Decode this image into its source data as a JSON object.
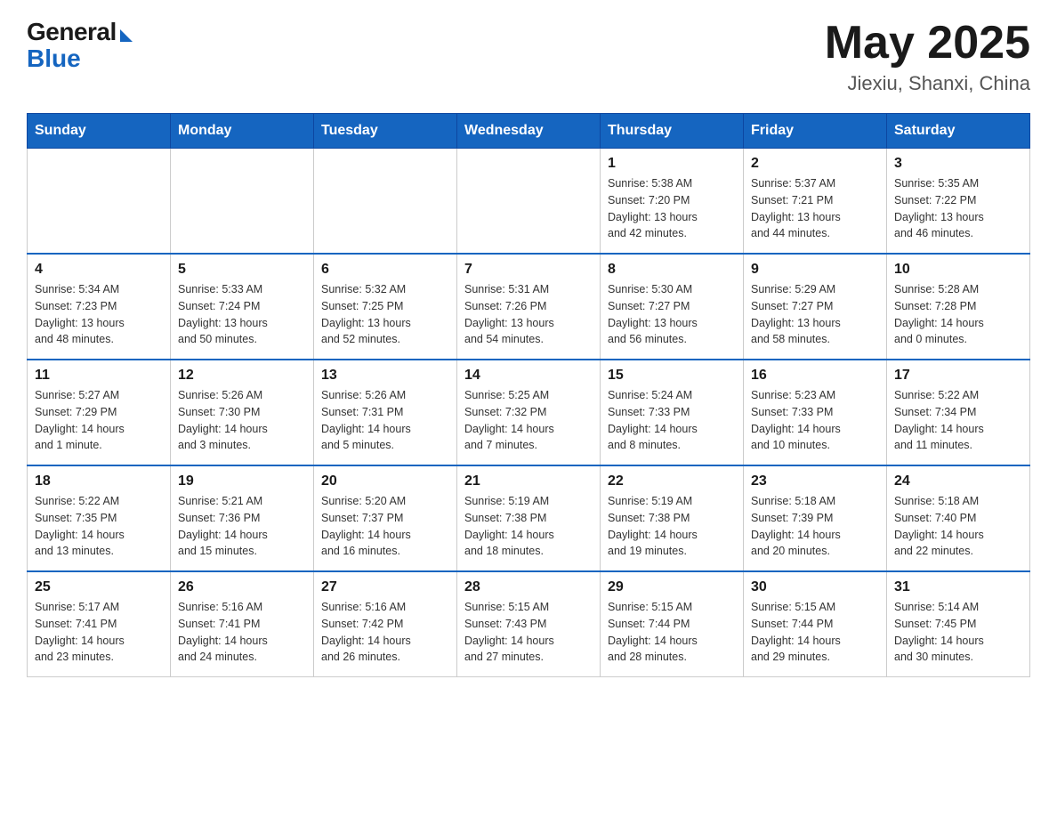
{
  "header": {
    "logo_general": "General",
    "logo_blue": "Blue",
    "month_year": "May 2025",
    "location": "Jiexiu, Shanxi, China"
  },
  "days_of_week": [
    "Sunday",
    "Monday",
    "Tuesday",
    "Wednesday",
    "Thursday",
    "Friday",
    "Saturday"
  ],
  "weeks": [
    [
      {
        "day": "",
        "info": ""
      },
      {
        "day": "",
        "info": ""
      },
      {
        "day": "",
        "info": ""
      },
      {
        "day": "",
        "info": ""
      },
      {
        "day": "1",
        "info": "Sunrise: 5:38 AM\nSunset: 7:20 PM\nDaylight: 13 hours\nand 42 minutes."
      },
      {
        "day": "2",
        "info": "Sunrise: 5:37 AM\nSunset: 7:21 PM\nDaylight: 13 hours\nand 44 minutes."
      },
      {
        "day": "3",
        "info": "Sunrise: 5:35 AM\nSunset: 7:22 PM\nDaylight: 13 hours\nand 46 minutes."
      }
    ],
    [
      {
        "day": "4",
        "info": "Sunrise: 5:34 AM\nSunset: 7:23 PM\nDaylight: 13 hours\nand 48 minutes."
      },
      {
        "day": "5",
        "info": "Sunrise: 5:33 AM\nSunset: 7:24 PM\nDaylight: 13 hours\nand 50 minutes."
      },
      {
        "day": "6",
        "info": "Sunrise: 5:32 AM\nSunset: 7:25 PM\nDaylight: 13 hours\nand 52 minutes."
      },
      {
        "day": "7",
        "info": "Sunrise: 5:31 AM\nSunset: 7:26 PM\nDaylight: 13 hours\nand 54 minutes."
      },
      {
        "day": "8",
        "info": "Sunrise: 5:30 AM\nSunset: 7:27 PM\nDaylight: 13 hours\nand 56 minutes."
      },
      {
        "day": "9",
        "info": "Sunrise: 5:29 AM\nSunset: 7:27 PM\nDaylight: 13 hours\nand 58 minutes."
      },
      {
        "day": "10",
        "info": "Sunrise: 5:28 AM\nSunset: 7:28 PM\nDaylight: 14 hours\nand 0 minutes."
      }
    ],
    [
      {
        "day": "11",
        "info": "Sunrise: 5:27 AM\nSunset: 7:29 PM\nDaylight: 14 hours\nand 1 minute."
      },
      {
        "day": "12",
        "info": "Sunrise: 5:26 AM\nSunset: 7:30 PM\nDaylight: 14 hours\nand 3 minutes."
      },
      {
        "day": "13",
        "info": "Sunrise: 5:26 AM\nSunset: 7:31 PM\nDaylight: 14 hours\nand 5 minutes."
      },
      {
        "day": "14",
        "info": "Sunrise: 5:25 AM\nSunset: 7:32 PM\nDaylight: 14 hours\nand 7 minutes."
      },
      {
        "day": "15",
        "info": "Sunrise: 5:24 AM\nSunset: 7:33 PM\nDaylight: 14 hours\nand 8 minutes."
      },
      {
        "day": "16",
        "info": "Sunrise: 5:23 AM\nSunset: 7:33 PM\nDaylight: 14 hours\nand 10 minutes."
      },
      {
        "day": "17",
        "info": "Sunrise: 5:22 AM\nSunset: 7:34 PM\nDaylight: 14 hours\nand 11 minutes."
      }
    ],
    [
      {
        "day": "18",
        "info": "Sunrise: 5:22 AM\nSunset: 7:35 PM\nDaylight: 14 hours\nand 13 minutes."
      },
      {
        "day": "19",
        "info": "Sunrise: 5:21 AM\nSunset: 7:36 PM\nDaylight: 14 hours\nand 15 minutes."
      },
      {
        "day": "20",
        "info": "Sunrise: 5:20 AM\nSunset: 7:37 PM\nDaylight: 14 hours\nand 16 minutes."
      },
      {
        "day": "21",
        "info": "Sunrise: 5:19 AM\nSunset: 7:38 PM\nDaylight: 14 hours\nand 18 minutes."
      },
      {
        "day": "22",
        "info": "Sunrise: 5:19 AM\nSunset: 7:38 PM\nDaylight: 14 hours\nand 19 minutes."
      },
      {
        "day": "23",
        "info": "Sunrise: 5:18 AM\nSunset: 7:39 PM\nDaylight: 14 hours\nand 20 minutes."
      },
      {
        "day": "24",
        "info": "Sunrise: 5:18 AM\nSunset: 7:40 PM\nDaylight: 14 hours\nand 22 minutes."
      }
    ],
    [
      {
        "day": "25",
        "info": "Sunrise: 5:17 AM\nSunset: 7:41 PM\nDaylight: 14 hours\nand 23 minutes."
      },
      {
        "day": "26",
        "info": "Sunrise: 5:16 AM\nSunset: 7:41 PM\nDaylight: 14 hours\nand 24 minutes."
      },
      {
        "day": "27",
        "info": "Sunrise: 5:16 AM\nSunset: 7:42 PM\nDaylight: 14 hours\nand 26 minutes."
      },
      {
        "day": "28",
        "info": "Sunrise: 5:15 AM\nSunset: 7:43 PM\nDaylight: 14 hours\nand 27 minutes."
      },
      {
        "day": "29",
        "info": "Sunrise: 5:15 AM\nSunset: 7:44 PM\nDaylight: 14 hours\nand 28 minutes."
      },
      {
        "day": "30",
        "info": "Sunrise: 5:15 AM\nSunset: 7:44 PM\nDaylight: 14 hours\nand 29 minutes."
      },
      {
        "day": "31",
        "info": "Sunrise: 5:14 AM\nSunset: 7:45 PM\nDaylight: 14 hours\nand 30 minutes."
      }
    ]
  ]
}
